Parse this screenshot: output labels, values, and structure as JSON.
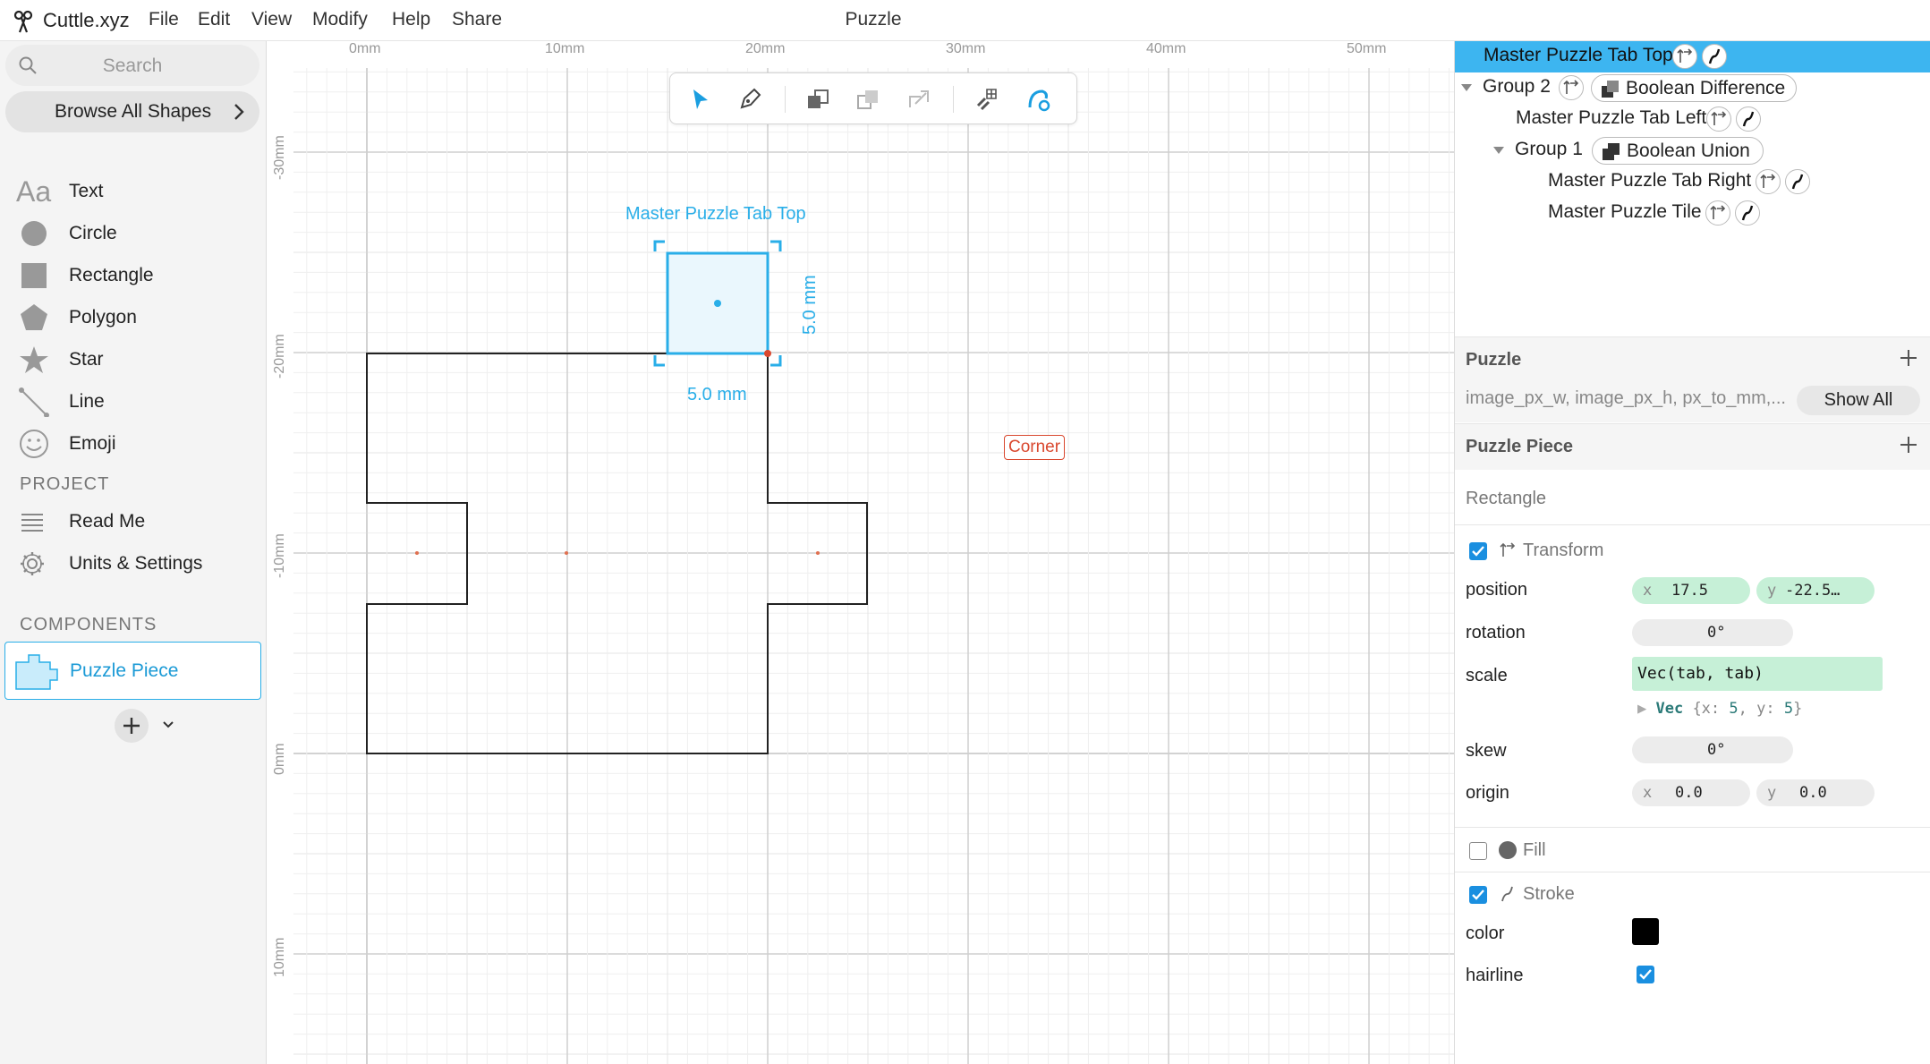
{
  "app": {
    "name": "Cuttle.xyz",
    "doc_title": "Puzzle",
    "menu": [
      "File",
      "Edit",
      "View",
      "Modify",
      "Help",
      "Share"
    ]
  },
  "sidebar": {
    "search_placeholder": "Search",
    "browse_label": "Browse All Shapes",
    "shapes": [
      {
        "label": "Text",
        "icon": "text-icon"
      },
      {
        "label": "Circle",
        "icon": "circle-icon"
      },
      {
        "label": "Rectangle",
        "icon": "rectangle-icon"
      },
      {
        "label": "Polygon",
        "icon": "polygon-icon"
      },
      {
        "label": "Star",
        "icon": "star-icon"
      },
      {
        "label": "Line",
        "icon": "line-icon"
      },
      {
        "label": "Emoji",
        "icon": "emoji-icon"
      }
    ],
    "project_title": "PROJECT",
    "project_items": [
      {
        "label": "Read Me",
        "icon": "list-icon"
      },
      {
        "label": "Units & Settings",
        "icon": "gear-icon"
      }
    ],
    "components_title": "COMPONENTS",
    "component": "Puzzle Piece"
  },
  "canvas": {
    "ruler_x": [
      "0mm",
      "10mm",
      "20mm",
      "30mm",
      "40mm",
      "50mm"
    ],
    "ruler_y": [
      "-30mm",
      "-20mm",
      "-10mm",
      "0mm",
      "10mm"
    ],
    "selection_label": "Master Puzzle Tab Top",
    "width_label": "5.0 mm",
    "height_label": "5.0 mm",
    "corner_tag": "Corner"
  },
  "tree": {
    "items": [
      {
        "label": "Master Puzzle Tab Top"
      },
      {
        "label": "Group 2",
        "op": "Boolean Difference"
      },
      {
        "label": "Master Puzzle Tab Left"
      },
      {
        "label": "Group 1",
        "op": "Boolean Union"
      },
      {
        "label": "Master Puzzle Tab Right"
      },
      {
        "label": "Master Puzzle Tile"
      }
    ]
  },
  "inspector": {
    "puzzle_title": "Puzzle",
    "puzzle_params": "image_px_w, image_px_h, px_to_mm,...",
    "show_all": "Show All",
    "piece_title": "Puzzle Piece",
    "shape_type": "Rectangle",
    "transform_label": "Transform",
    "position_label": "position",
    "position_x": "17.5",
    "position_y": "-22.5…",
    "rotation_label": "rotation",
    "rotation_val": "0°",
    "scale_label": "scale",
    "scale_expr": "Vec(tab, tab)",
    "scale_vec_type": "Vec",
    "scale_vec_x": "5",
    "scale_vec_y": "5",
    "skew_label": "skew",
    "skew_val": "0°",
    "origin_label": "origin",
    "origin_x": "0.0",
    "origin_y": "0.0",
    "fill_label": "Fill",
    "stroke_label": "Stroke",
    "color_label": "color",
    "stroke_color": "#000000",
    "hairline_label": "hairline"
  },
  "colors": {
    "accent": "#29aee8",
    "selection_bg": "#3db5f0",
    "corner": "#d9482f",
    "code_bg": "#c6f0d7"
  }
}
